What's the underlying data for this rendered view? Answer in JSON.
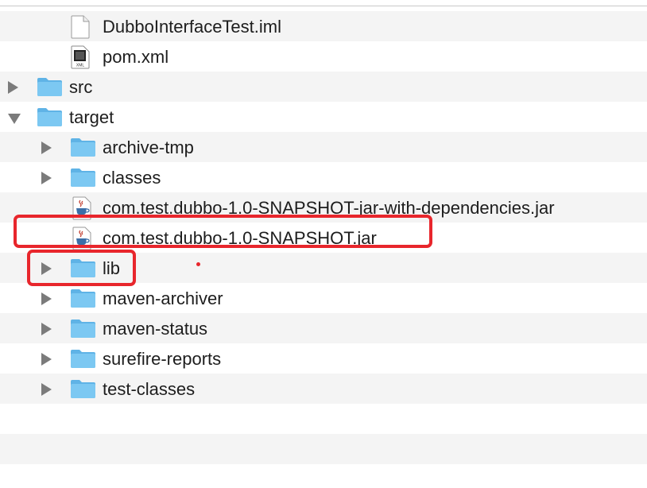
{
  "files": [
    {
      "name": "DubboInterfaceTest.iml",
      "kind": "document",
      "level": 1,
      "disclosure": "none",
      "icon": "document-icon"
    },
    {
      "name": "pom.xml",
      "kind": "xml",
      "level": 1,
      "disclosure": "none",
      "icon": "xml-file-icon",
      "icon_text": "XML"
    },
    {
      "name": "src",
      "kind": "folder",
      "level": 0,
      "disclosure": "collapsed",
      "icon": "folder-icon"
    },
    {
      "name": "target",
      "kind": "folder",
      "level": 0,
      "disclosure": "expanded",
      "icon": "folder-icon"
    },
    {
      "name": "archive-tmp",
      "kind": "folder",
      "level": 1,
      "disclosure": "collapsed",
      "icon": "folder-icon"
    },
    {
      "name": "classes",
      "kind": "folder",
      "level": 1,
      "disclosure": "collapsed",
      "icon": "folder-icon"
    },
    {
      "name": "com.test.dubbo-1.0-SNAPSHOT-jar-with-dependencies.jar",
      "kind": "jar",
      "level": 2,
      "disclosure": "none",
      "icon": "java-jar-icon"
    },
    {
      "name": "com.test.dubbo-1.0-SNAPSHOT.jar",
      "kind": "jar",
      "level": 2,
      "disclosure": "none",
      "icon": "java-jar-icon"
    },
    {
      "name": "lib",
      "kind": "folder",
      "level": 1,
      "disclosure": "collapsed",
      "icon": "folder-icon"
    },
    {
      "name": "maven-archiver",
      "kind": "folder",
      "level": 1,
      "disclosure": "collapsed",
      "icon": "folder-icon"
    },
    {
      "name": "maven-status",
      "kind": "folder",
      "level": 1,
      "disclosure": "collapsed",
      "icon": "folder-icon"
    },
    {
      "name": "surefire-reports",
      "kind": "folder",
      "level": 1,
      "disclosure": "collapsed",
      "icon": "folder-icon"
    },
    {
      "name": "test-classes",
      "kind": "folder",
      "level": 1,
      "disclosure": "collapsed",
      "icon": "folder-icon"
    }
  ],
  "annotations": {
    "highlight_color": "#e8262c",
    "highlighted_items": [
      "com.test.dubbo-1.0-SNAPSHOT.jar",
      "lib"
    ]
  },
  "colors": {
    "folder_front": "#7cc8f2",
    "folder_back": "#5fb3e6",
    "disclosure": "#7b7b7b",
    "row_stripe": "#f4f4f4"
  }
}
